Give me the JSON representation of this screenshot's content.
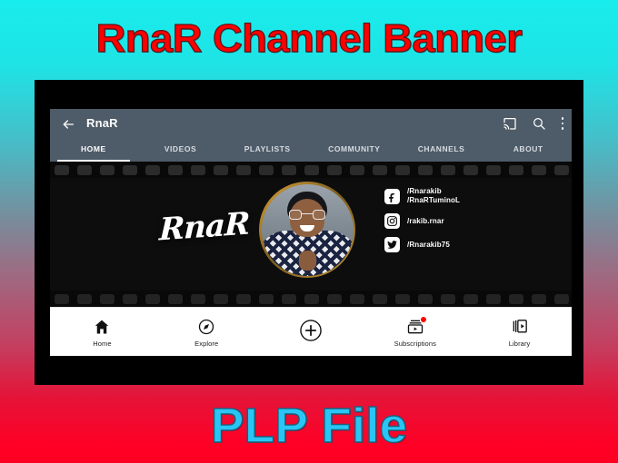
{
  "poster": {
    "top_title": "RnaR Channel Banner",
    "bottom_title": "PLP File",
    "title_color": "#FF0000",
    "bottom_title_color": "#29C6F5",
    "gradient_top": "#19ECEC",
    "gradient_bottom": "#FF0022"
  },
  "app": {
    "header": {
      "back_icon": "back-arrow-icon",
      "channel_title": "RnaR",
      "cast_icon": "cast-icon",
      "search_icon": "search-icon",
      "overflow_icon": "kebab-menu-icon",
      "bar_color": "#4E5B68"
    },
    "tabs": [
      {
        "label": "HOME",
        "active": true
      },
      {
        "label": "VIDEOS",
        "active": false
      },
      {
        "label": "PLAYLISTS",
        "active": false
      },
      {
        "label": "COMMUNITY",
        "active": false
      },
      {
        "label": "CHANNELS",
        "active": false
      },
      {
        "label": "ABOUT",
        "active": false
      }
    ],
    "banner": {
      "style": "filmstrip",
      "background": "#0D0D0D",
      "script_logo": "RnaR",
      "avatar": {
        "name": "channel-avatar-portrait",
        "ring_color": "#D9A13B"
      },
      "socials": [
        {
          "platform": "facebook",
          "icon": "facebook-icon",
          "line1": "/Rnarakib",
          "line2": "/RnaRTuminoL"
        },
        {
          "platform": "instagram",
          "icon": "instagram-icon",
          "line1": "/rakib.rnar",
          "line2": ""
        },
        {
          "platform": "twitter",
          "icon": "twitter-icon",
          "line1": "/Rnarakib75",
          "line2": ""
        }
      ]
    },
    "bottom_nav": [
      {
        "label": "Home",
        "icon": "home-icon",
        "badge": false
      },
      {
        "label": "Explore",
        "icon": "compass-icon",
        "badge": false
      },
      {
        "label": "",
        "icon": "create-plus-icon",
        "badge": false
      },
      {
        "label": "Subscriptions",
        "icon": "subscriptions-icon",
        "badge": true
      },
      {
        "label": "Library",
        "icon": "library-icon",
        "badge": false
      }
    ]
  }
}
